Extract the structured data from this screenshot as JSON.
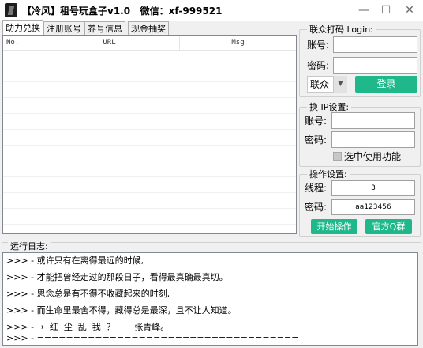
{
  "window": {
    "title": "【冷风】租号玩盒子v1.0   微信：xf-999521",
    "minimize_glyph": "—",
    "maximize_glyph": "☐",
    "close_glyph": "✕"
  },
  "tabs": [
    {
      "label": "助力兑换",
      "active": true
    },
    {
      "label": "注册账号",
      "active": false
    },
    {
      "label": "养号信息",
      "active": false
    },
    {
      "label": "现金抽奖",
      "active": false
    }
  ],
  "list": {
    "columns": [
      "No.",
      "URL",
      "Msg"
    ],
    "rows": []
  },
  "login_group": {
    "title": "联众打码 Login:",
    "account_label": "账号:",
    "account_value": "",
    "password_label": "密码:",
    "password_value": "",
    "provider_selected": "联众",
    "login_button": "登录"
  },
  "ip_group": {
    "title": "换 IP设置:",
    "account_label": "账号:",
    "account_value": "",
    "password_label": "密码:",
    "password_value": "",
    "checkbox_label": "选中使用功能",
    "checked": false
  },
  "ops_group": {
    "title": "操作设置:",
    "threads_label": "线程:",
    "threads_value": "3",
    "password_label": "密码:",
    "password_value": "aa123456",
    "start_button": "开始操作",
    "qq_group_button": "官方Q群"
  },
  "log": {
    "title": "运行日志:",
    "lines": [
      ">>> - 或许只有在离得最远的时候,",
      ">>> - 才能把曾经走过的那段日子，看得最真确最真切。",
      ">>> - 思念总是有不得不收藏起来的时刻,",
      ">>> - 而生命里最舍不得，藏得总是最深，且不让人知道。",
      ">>> - →  红  尘  乱  我  ？       张青峰。",
      ">>> - ===================================="
    ]
  },
  "colors": {
    "accent_green": "#1fb88a"
  }
}
